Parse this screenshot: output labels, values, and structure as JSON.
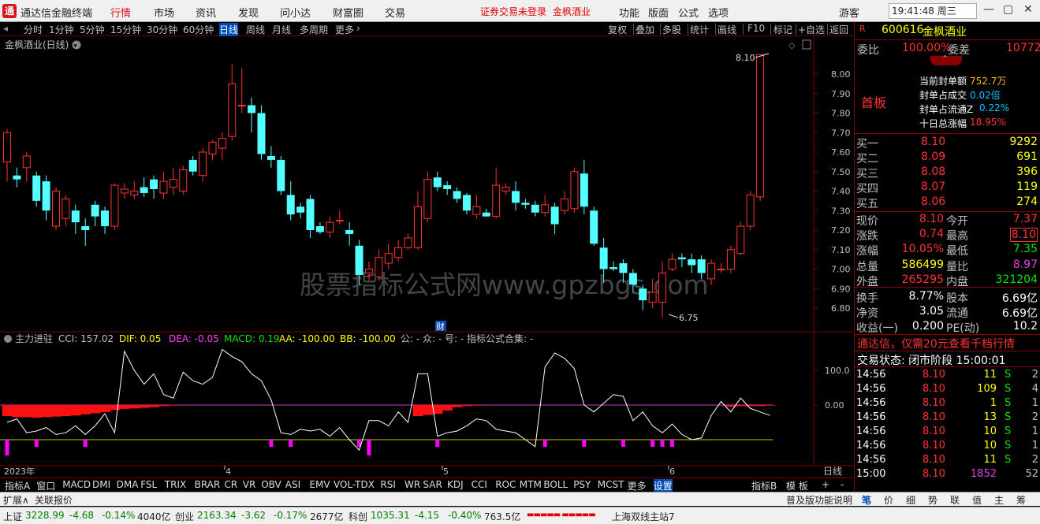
{
  "topbar": {
    "app_name": "通达信金融终端",
    "menus": [
      "行情",
      "市场",
      "资讯",
      "发现",
      "问小达",
      "财富圈",
      "交易"
    ],
    "active_menu": "行情",
    "notice1": "证券交易未登录",
    "notice2": "金枫酒业",
    "right_menus": [
      "功能",
      "版面",
      "公式",
      "选项"
    ],
    "user": "游客",
    "clock": "19:41:48 周三"
  },
  "periods": [
    "分时",
    "1分钟",
    "5分钟",
    "15分钟",
    "30分钟",
    "60分钟",
    "日线",
    "周线",
    "月线",
    "多周期",
    "更多"
  ],
  "active_period": "日线",
  "tools": [
    "复权",
    "叠加",
    "多股",
    "统计",
    "画线",
    "F10",
    "标记",
    "+自选",
    "返回"
  ],
  "chart": {
    "title": "金枫酒业(日线)",
    "high_label": "8.10",
    "low_label": "6.75",
    "watermark": "股票指标公式网www.gpzbgs.com",
    "cai_marker": "财",
    "price_axis": [
      "8.00",
      "7.90",
      "7.80",
      "7.70",
      "7.60",
      "7.50",
      "7.40",
      "7.30",
      "7.20",
      "7.10",
      "7.00",
      "6.90",
      "6.80"
    ],
    "ind_axis": [
      "100.0",
      "0.00"
    ],
    "date_labels": [
      "2023年",
      "4",
      "5",
      "6"
    ],
    "period_label": "日线"
  },
  "chart_data": {
    "type": "candlestick",
    "series_name": "金枫酒业(日线)",
    "ylim": [
      6.74,
      8.18
    ],
    "candles": [
      [
        7.55,
        7.7,
        7.72,
        7.45
      ],
      [
        7.48,
        7.46,
        7.52,
        7.42
      ],
      [
        7.52,
        7.58,
        7.6,
        7.45
      ],
      [
        7.48,
        7.35,
        7.5,
        7.32
      ],
      [
        7.45,
        7.3,
        7.48,
        7.25
      ],
      [
        7.22,
        7.4,
        7.42,
        7.2
      ],
      [
        7.26,
        7.36,
        7.38,
        7.22
      ],
      [
        7.3,
        7.24,
        7.33,
        7.18
      ],
      [
        7.22,
        7.2,
        7.26,
        7.12
      ],
      [
        7.33,
        7.27,
        7.35,
        7.22
      ],
      [
        7.3,
        7.22,
        7.32,
        7.18
      ],
      [
        7.22,
        7.43,
        7.44,
        7.2
      ],
      [
        7.39,
        7.41,
        7.44,
        7.36
      ],
      [
        7.38,
        7.4,
        7.45,
        7.36
      ],
      [
        7.42,
        7.39,
        7.47,
        7.37
      ],
      [
        7.46,
        7.41,
        7.48,
        7.36
      ],
      [
        7.39,
        7.45,
        7.5,
        7.36
      ],
      [
        7.42,
        7.46,
        7.52,
        7.38
      ],
      [
        7.4,
        7.51,
        7.53,
        7.38
      ],
      [
        7.56,
        7.5,
        7.58,
        7.48
      ],
      [
        7.48,
        7.6,
        7.62,
        7.45
      ],
      [
        7.59,
        7.65,
        7.66,
        7.56
      ],
      [
        7.62,
        7.67,
        7.7,
        7.56
      ],
      [
        7.68,
        7.95,
        8.05,
        7.66
      ],
      [
        7.84,
        7.84,
        8.03,
        7.8
      ],
      [
        7.84,
        7.8,
        7.88,
        7.7
      ],
      [
        7.8,
        7.59,
        7.84,
        7.56
      ],
      [
        7.58,
        7.56,
        7.63,
        7.52
      ],
      [
        7.56,
        7.4,
        7.58,
        7.38
      ],
      [
        7.38,
        7.28,
        7.45,
        7.25
      ],
      [
        7.32,
        7.29,
        7.34,
        7.26
      ],
      [
        7.36,
        7.2,
        7.38,
        7.16
      ],
      [
        7.22,
        7.19,
        7.24,
        7.18
      ],
      [
        7.19,
        7.24,
        7.27,
        7.16
      ],
      [
        7.25,
        7.25,
        7.3,
        7.23
      ],
      [
        7.2,
        7.18,
        7.24,
        7.12
      ],
      [
        7.12,
        6.97,
        7.15,
        6.92
      ],
      [
        6.98,
        7.0,
        7.04,
        6.94
      ],
      [
        6.96,
        7.06,
        7.1,
        6.94
      ],
      [
        7.03,
        7.08,
        7.13,
        7.0
      ],
      [
        7.06,
        7.11,
        7.15,
        7.04
      ],
      [
        7.11,
        7.16,
        7.18,
        7.1
      ],
      [
        7.11,
        7.32,
        7.4,
        7.1
      ],
      [
        7.26,
        7.46,
        7.5,
        7.24
      ],
      [
        7.47,
        7.42,
        7.5,
        7.4
      ],
      [
        7.43,
        7.41,
        7.45,
        7.38
      ],
      [
        7.4,
        7.36,
        7.42,
        7.34
      ],
      [
        7.38,
        7.3,
        7.39,
        7.28
      ],
      [
        7.28,
        7.32,
        7.38,
        7.26
      ],
      [
        7.29,
        7.27,
        7.31,
        7.27
      ],
      [
        7.27,
        7.43,
        7.52,
        7.26
      ],
      [
        7.4,
        7.42,
        7.44,
        7.38
      ],
      [
        7.4,
        7.34,
        7.45,
        7.3
      ],
      [
        7.34,
        7.33,
        7.36,
        7.31
      ],
      [
        7.33,
        7.29,
        7.35,
        7.27
      ],
      [
        7.29,
        7.33,
        7.38,
        7.27
      ],
      [
        7.32,
        7.23,
        7.34,
        7.18
      ],
      [
        7.3,
        7.36,
        7.4,
        7.28
      ],
      [
        7.31,
        7.5,
        7.52,
        7.29
      ],
      [
        7.49,
        7.32,
        7.56,
        7.28
      ],
      [
        7.3,
        7.13,
        7.32,
        7.12
      ],
      [
        7.11,
        7.0,
        7.16,
        6.93
      ],
      [
        7.01,
        7.0,
        7.04,
        6.99
      ],
      [
        7.03,
        6.98,
        7.05,
        6.93
      ],
      [
        6.98,
        6.92,
        7.0,
        6.88
      ],
      [
        6.9,
        6.84,
        6.92,
        6.79
      ],
      [
        6.83,
        6.88,
        6.95,
        6.8
      ],
      [
        6.83,
        6.98,
        7.04,
        6.75
      ],
      [
        7.0,
        7.05,
        7.08,
        6.99
      ],
      [
        7.06,
        7.05,
        7.08,
        7.01
      ],
      [
        7.05,
        7.02,
        7.08,
        6.98
      ],
      [
        7.05,
        6.98,
        7.07,
        6.95
      ],
      [
        6.95,
        7.03,
        7.05,
        6.92
      ],
      [
        7.0,
        7.0,
        7.03,
        6.98
      ],
      [
        7.0,
        7.1,
        7.12,
        6.98
      ],
      [
        7.08,
        7.22,
        7.24,
        7.07
      ],
      [
        7.22,
        7.38,
        7.4,
        7.2
      ],
      [
        7.37,
        8.1,
        8.1,
        7.35
      ]
    ],
    "volume_ignore": null,
    "indicator": {
      "name": "主力进驻",
      "readouts": [
        {
          "k": "CCI",
          "v": "157.02",
          "c": "#c0c0c0"
        },
        {
          "k": "DIF",
          "v": "0.05",
          "c": "#ffff00"
        },
        {
          "k": "DEA",
          "v": "-0.05",
          "c": "#ff40ff"
        },
        {
          "k": "MACD",
          "v": "0.19",
          "c": "#00e600"
        },
        {
          "k": "AA",
          "v": "-100.00",
          "c": "#ffff00"
        },
        {
          "k": "BB",
          "v": "-100.00",
          "c": "#ffff00"
        }
      ],
      "tail": "公: - 众: - 号: - 指标公式合集: -",
      "cci": [
        -50,
        -40,
        -80,
        -75,
        -65,
        -85,
        -80,
        -60,
        -85,
        -60,
        -25,
        -80,
        155,
        100,
        60,
        90,
        30,
        20,
        95,
        70,
        60,
        80,
        160,
        140,
        125,
        90,
        70,
        15,
        -80,
        -85,
        -70,
        -75,
        -70,
        -90,
        -65,
        -100,
        -130,
        -45,
        -45,
        -60,
        -20,
        -50,
        90,
        90,
        -90,
        -80,
        -75,
        -60,
        -40,
        -45,
        -70,
        -75,
        -80,
        -100,
        -120,
        110,
        150,
        135,
        105,
        0,
        -20,
        5,
        30,
        25,
        -45,
        -20,
        -60,
        -80,
        -55,
        -85,
        -100,
        -95,
        -30,
        10,
        -20,
        20,
        -10,
        -20,
        -30
      ],
      "macd": [
        -0.2,
        -0.22,
        -0.22,
        -0.23,
        -0.22,
        -0.21,
        -0.2,
        -0.19,
        -0.17,
        -0.15,
        -0.13,
        -0.09,
        -0.07,
        -0.06,
        -0.05,
        -0.04,
        -0.02,
        -0.01,
        0,
        0,
        0,
        0,
        0,
        0,
        0,
        0,
        0,
        0,
        0,
        0,
        0,
        0,
        0,
        0,
        0,
        0,
        0,
        0,
        0,
        0,
        0,
        0,
        -0.2,
        -0.18,
        -0.16,
        -0.1,
        -0.04,
        -0.02,
        -0.01,
        0,
        0,
        0,
        0,
        0,
        0,
        0,
        0,
        0,
        0,
        0,
        0,
        0,
        0,
        0,
        0,
        0,
        0,
        0,
        0,
        0,
        0,
        0,
        0,
        0,
        -0.03,
        -0.02,
        -0.02,
        -0.02,
        -0.01
      ],
      "markers": [
        0,
        3,
        8,
        27,
        29,
        36,
        37,
        44,
        55,
        59,
        63,
        66,
        67,
        68
      ]
    }
  },
  "bottom_tabs": [
    "指标A",
    "窗口",
    "MACD",
    "DMI",
    "DMA",
    "FSL",
    "TRIX",
    "BRAR",
    "CR",
    "VR",
    "OBV",
    "ASI",
    "EMV",
    "VOL-TDX",
    "RSI",
    "WR",
    "SAR",
    "KDJ",
    "CCI",
    "ROC",
    "MTM",
    "BOLL",
    "PSY",
    "MCST",
    "更多",
    "设置"
  ],
  "active_tab": "设置",
  "bottom_right": [
    "指标B",
    "模 板",
    "+",
    "-"
  ],
  "subbar": {
    "left": [
      "扩展∧",
      "关联报价"
    ],
    "right": "普及版功能说明",
    "icons": [
      "笔",
      "价",
      "细",
      "势",
      "联",
      "值",
      "主",
      "筹"
    ]
  },
  "status": {
    "items": [
      {
        "name": "上证",
        "value": "3228.99",
        "chg": "-4.68",
        "pct": "-0.14%",
        "amt": "4040亿"
      },
      {
        "name": "创业",
        "value": "2163.34",
        "chg": "-3.62",
        "pct": "-0.17%",
        "amt": "2677亿"
      },
      {
        "name": "科创",
        "value": "1035.31",
        "chg": "-4.15",
        "pct": "-0.40%",
        "amt": "763.5亿"
      }
    ],
    "server": "上海双线主站7"
  },
  "panel": {
    "code": "600616",
    "name": "金枫酒业",
    "weibi_label": "委比",
    "weibi": "100.00%",
    "weicha_label": "委差",
    "weicha": "10772",
    "board": "首板",
    "board_info": [
      {
        "k": "当前封单额",
        "v": "752.7万"
      },
      {
        "k": "封单占成交",
        "v": "0.02倍"
      },
      {
        "k": "封单占流通Z",
        "v": "0.22%"
      },
      {
        "k": "十日总涨幅",
        "v": "18.95%"
      }
    ],
    "bids": [
      {
        "k": "买一",
        "p": "8.10",
        "v": "9292"
      },
      {
        "k": "买二",
        "p": "8.09",
        "v": "691"
      },
      {
        "k": "买三",
        "p": "8.08",
        "v": "396"
      },
      {
        "k": "买四",
        "p": "8.07",
        "v": "119"
      },
      {
        "k": "买五",
        "p": "8.06",
        "v": "274"
      }
    ],
    "quotes": [
      {
        "l": "现价",
        "lv": "8.10",
        "lc": "red",
        "r": "今开",
        "rv": "7.37",
        "rc": "red"
      },
      {
        "l": "涨跌",
        "lv": "0.74",
        "lc": "red",
        "r": "最高",
        "rv": "8.10",
        "rc": "red"
      },
      {
        "l": "涨幅",
        "lv": "10.05%",
        "lc": "red",
        "r": "最低",
        "rv": "7.35",
        "rc": "grn"
      },
      {
        "l": "总量",
        "lv": "586499",
        "lc": "yel",
        "r": "量比",
        "rv": "8.97",
        "rc": "mag"
      },
      {
        "l": "外盘",
        "lv": "265295",
        "lc": "red",
        "r": "内盘",
        "rv": "321204",
        "rc": "grn"
      },
      {
        "l": "换手",
        "lv": "8.77%",
        "lc": "wht",
        "r": "股本",
        "rv": "6.69亿",
        "rc": "wht"
      },
      {
        "l": "净资",
        "lv": "3.05",
        "lc": "wht",
        "r": "流通",
        "rv": "6.69亿",
        "rc": "wht"
      },
      {
        "l": "收益(一)",
        "lv": "0.200",
        "lc": "wht",
        "r": "PE(动)",
        "rv": "10.2",
        "rc": "wht"
      }
    ],
    "ad": "通达信，仅需20元查看千档行情",
    "trade_status": "交易状态: 闭市阶段 15:00:01",
    "ticks": [
      {
        "t": "14:56",
        "p": "8.10",
        "v": "11",
        "s": "S",
        "n": "2"
      },
      {
        "t": "14:56",
        "p": "8.10",
        "v": "109",
        "s": "S",
        "n": "4"
      },
      {
        "t": "14:56",
        "p": "8.10",
        "v": "1",
        "s": "S",
        "n": "1"
      },
      {
        "t": "14:56",
        "p": "8.10",
        "v": "13",
        "s": "S",
        "n": "2"
      },
      {
        "t": "14:56",
        "p": "8.10",
        "v": "10",
        "s": "S",
        "n": "1"
      },
      {
        "t": "14:56",
        "p": "8.10",
        "v": "10",
        "s": "S",
        "n": "1"
      },
      {
        "t": "14:56",
        "p": "8.10",
        "v": "11",
        "s": "S",
        "n": "2"
      },
      {
        "t": "15:00",
        "p": "8.10",
        "v": "1852",
        "s": "",
        "n": "52"
      }
    ]
  },
  "colors": {
    "up": "#ff3232",
    "down": "#54ffff",
    "bg": "#000000",
    "grid": "#800000"
  }
}
